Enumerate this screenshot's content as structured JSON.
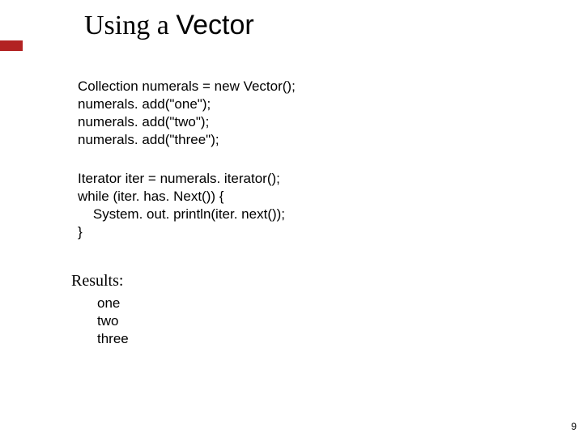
{
  "title": {
    "prefix": "Using a ",
    "mono": "Vector"
  },
  "code": {
    "block1": "Collection numerals = new Vector();\nnumerals. add(\"one\");\nnumerals. add(\"two\");\nnumerals. add(\"three\");",
    "block2": "Iterator iter = numerals. iterator();\nwhile (iter. has. Next()) {\n    System. out. println(iter. next());\n}"
  },
  "results": {
    "label": "Results:",
    "output": "one\ntwo\nthree"
  },
  "page_number": "9",
  "accent_color": "#b22222"
}
